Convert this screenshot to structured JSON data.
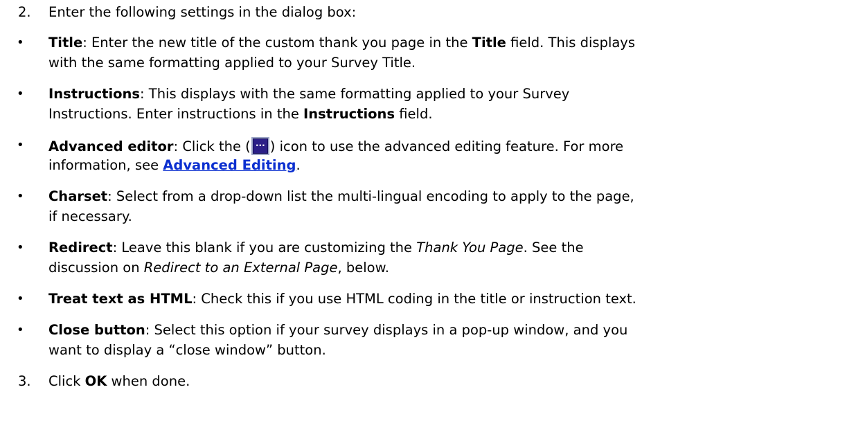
{
  "step2": {
    "number": "2.",
    "text": "Enter the following settings in the dialog box:"
  },
  "items": [
    {
      "label": "Title",
      "line1": ": Enter the new title of the custom thank you page in the ",
      "inline_bold": "Title",
      "line1_end": " field. This displays",
      "line2": "with the same formatting applied to your Survey Title."
    },
    {
      "label": "Instructions",
      "line1": ": This displays with the same formatting applied to your Survey",
      "line2_start": "Instructions. Enter instructions in the ",
      "inline_bold": "Instructions",
      "line2_end": " field."
    },
    {
      "label": "Advanced editor",
      "line1_start": ": Click the (",
      "icon": "ellipsis-icon",
      "line1_end": ") icon to use the advanced editing feature. For more",
      "line2_start": "information, see ",
      "link": "Advanced Editing",
      "line2_end": "."
    },
    {
      "label": "Charset",
      "line1": ": Select from a drop-down list the multi-lingual encoding to apply to the page,",
      "line2": "if necessary."
    },
    {
      "label": "Redirect",
      "line1_start": ": Leave this blank if you are customizing the ",
      "italic1": "Thank You Page",
      "line1_end": ". See the",
      "line2_start": "discussion on ",
      "italic2": "Redirect to an External Page",
      "line2_end": ", below."
    },
    {
      "label": "Treat text as HTML",
      "line1": ": Check this if you use HTML coding in the title or instruction text."
    },
    {
      "label": "Close button",
      "line1": ": Select this option if your survey displays in a pop-up window, and you",
      "line2": "want to display a “close window” button."
    }
  ],
  "step3": {
    "number": "3.",
    "text_start": "Click ",
    "bold": "OK",
    "text_end": " when done."
  },
  "bullet_char": "•",
  "colors": {
    "link": "#0b2fd0",
    "icon_bg": "#2b1f87",
    "icon_border": "#9da6c7"
  }
}
